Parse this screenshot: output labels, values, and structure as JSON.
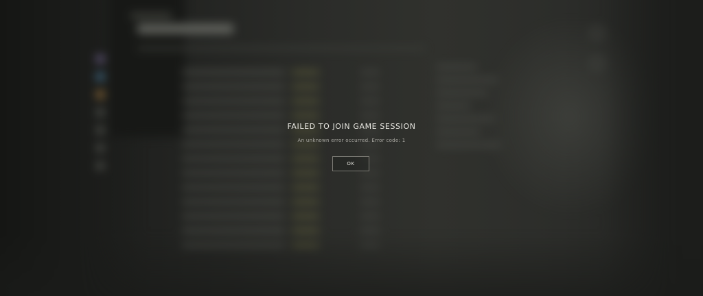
{
  "dialog": {
    "title": "FAILED TO JOIN GAME SESSION",
    "message": "An unknown error occurred. Error code: 1",
    "ok_label": "OK"
  },
  "colors": {
    "background": "#2b2c29",
    "title_text": "#e9e8e2",
    "message_text": "#a9a8a2",
    "button_border": "#7d7c76"
  }
}
